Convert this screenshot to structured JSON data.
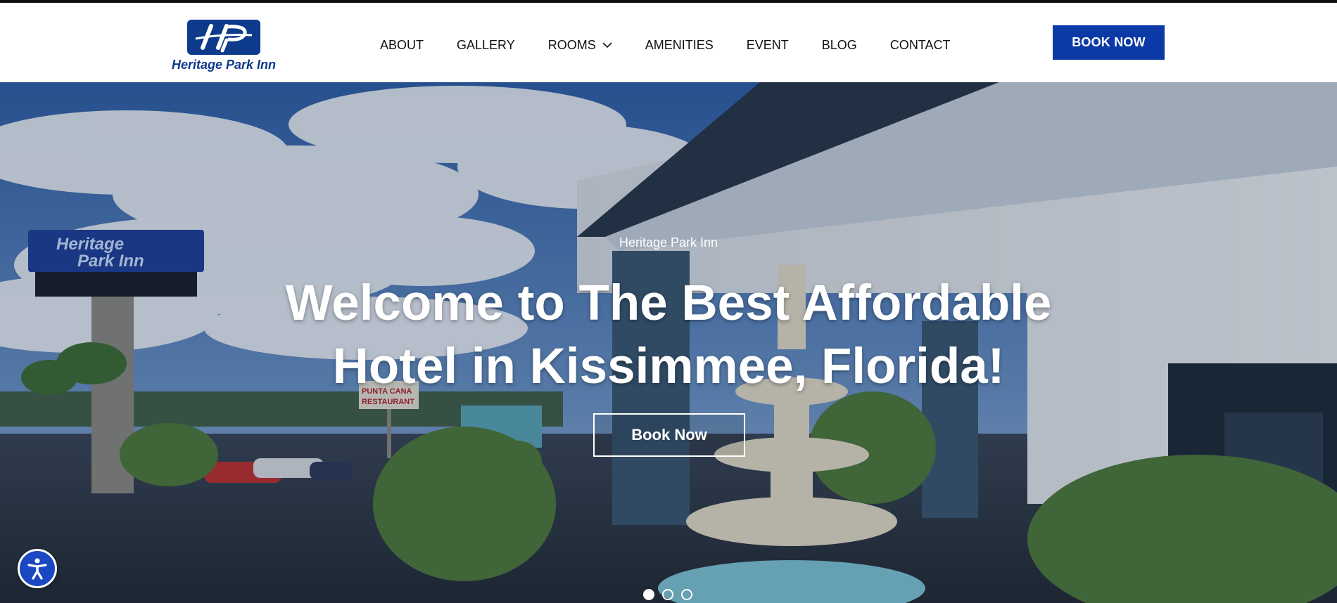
{
  "brand": {
    "logo_name": "Heritage Park Inn",
    "logo_mark": "HP",
    "color": "#0e3a8c"
  },
  "nav": {
    "items": [
      {
        "label": "ABOUT",
        "has_dropdown": false
      },
      {
        "label": "GALLERY",
        "has_dropdown": false
      },
      {
        "label": "ROOMS",
        "has_dropdown": true,
        "icon": "chevron-down-icon"
      },
      {
        "label": "AMENITIES",
        "has_dropdown": false
      },
      {
        "label": "EVENT",
        "has_dropdown": false
      },
      {
        "label": "BLOG",
        "has_dropdown": false
      },
      {
        "label": "CONTACT",
        "has_dropdown": false
      }
    ]
  },
  "header_cta": {
    "label": "BOOK NOW",
    "color": "#0b3aa6"
  },
  "hero": {
    "eyebrow": "Heritage Park Inn",
    "title": "Welcome to The Best Affordable Hotel in Kissimmee, Florida!",
    "cta_label": "Book Now",
    "sign_text_1": "Heritage",
    "sign_text_2": "Park Inn",
    "restaurant_sign_1": "PUNTA CANA",
    "restaurant_sign_2": "RESTAURANT",
    "slider": {
      "count": 3,
      "active_index": 0
    }
  },
  "accessibility": {
    "icon": "accessibility-icon",
    "color": "#1a47c2"
  }
}
